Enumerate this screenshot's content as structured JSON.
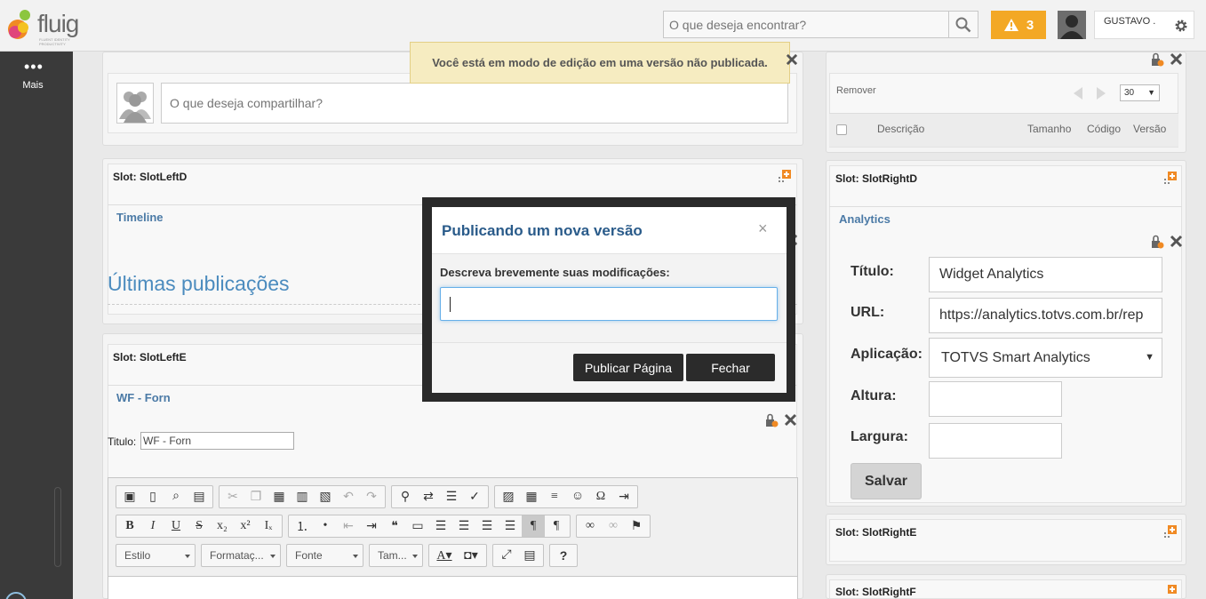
{
  "header": {
    "logo_text": "fluig",
    "logo_tagline": "FLUENT IDENTITY PRODUCTIVITY",
    "search_placeholder": "O que deseja encontrar?",
    "alert_count": "3",
    "user_name": "GUSTAVO ."
  },
  "rail": {
    "more_label": "Mais"
  },
  "notice": "Você está em modo de edição em uma versão não publicada.",
  "left": {
    "share_placeholder": "O que deseja compartilhar?",
    "slot_d_title": "Slot: SlotLeftD",
    "timeline_title": "Timeline",
    "ultimas_title": "Últimas publicações",
    "slot_e_title": "Slot: SlotLeftE",
    "wf_title": "WF - Forn",
    "titulo_label": "Titulo:",
    "titulo_value": "WF - Forn",
    "editor": {
      "style_select": "Estilo",
      "format_select": "Formataç...",
      "font_select": "Fonte",
      "size_select": "Tam..."
    }
  },
  "right": {
    "remover_label": "Remover",
    "page_size": "30",
    "columns": [
      "Descrição",
      "Tamanho",
      "Código",
      "Versão"
    ],
    "slot_d_title": "Slot: SlotRightD",
    "analytics_title": "Analytics",
    "form": {
      "titulo_label": "Título:",
      "titulo_value": "Widget Analytics",
      "url_label": "URL:",
      "url_value": "https://analytics.totvs.com.br/rep",
      "app_label": "Aplicação:",
      "app_value": "TOTVS Smart Analytics",
      "altura_label": "Altura:",
      "largura_label": "Largura:",
      "save_label": "Salvar"
    },
    "slot_e_title": "Slot: SlotRightE",
    "slot_f_title": "Slot: SlotRightF"
  },
  "modal": {
    "title": "Publicando um nova versão",
    "close_glyph": "×",
    "prompt": "Descreva brevemente suas modificações:",
    "input_value": "",
    "publish_label": "Publicar Página",
    "close_label": "Fechar"
  },
  "colors": {
    "accent_orange": "#f3a825",
    "title_blue": "#4b7aa6",
    "modal_title_blue": "#2a5b8a",
    "dark_button": "#2b2b2b",
    "rail_bg": "#3a3a3a"
  }
}
